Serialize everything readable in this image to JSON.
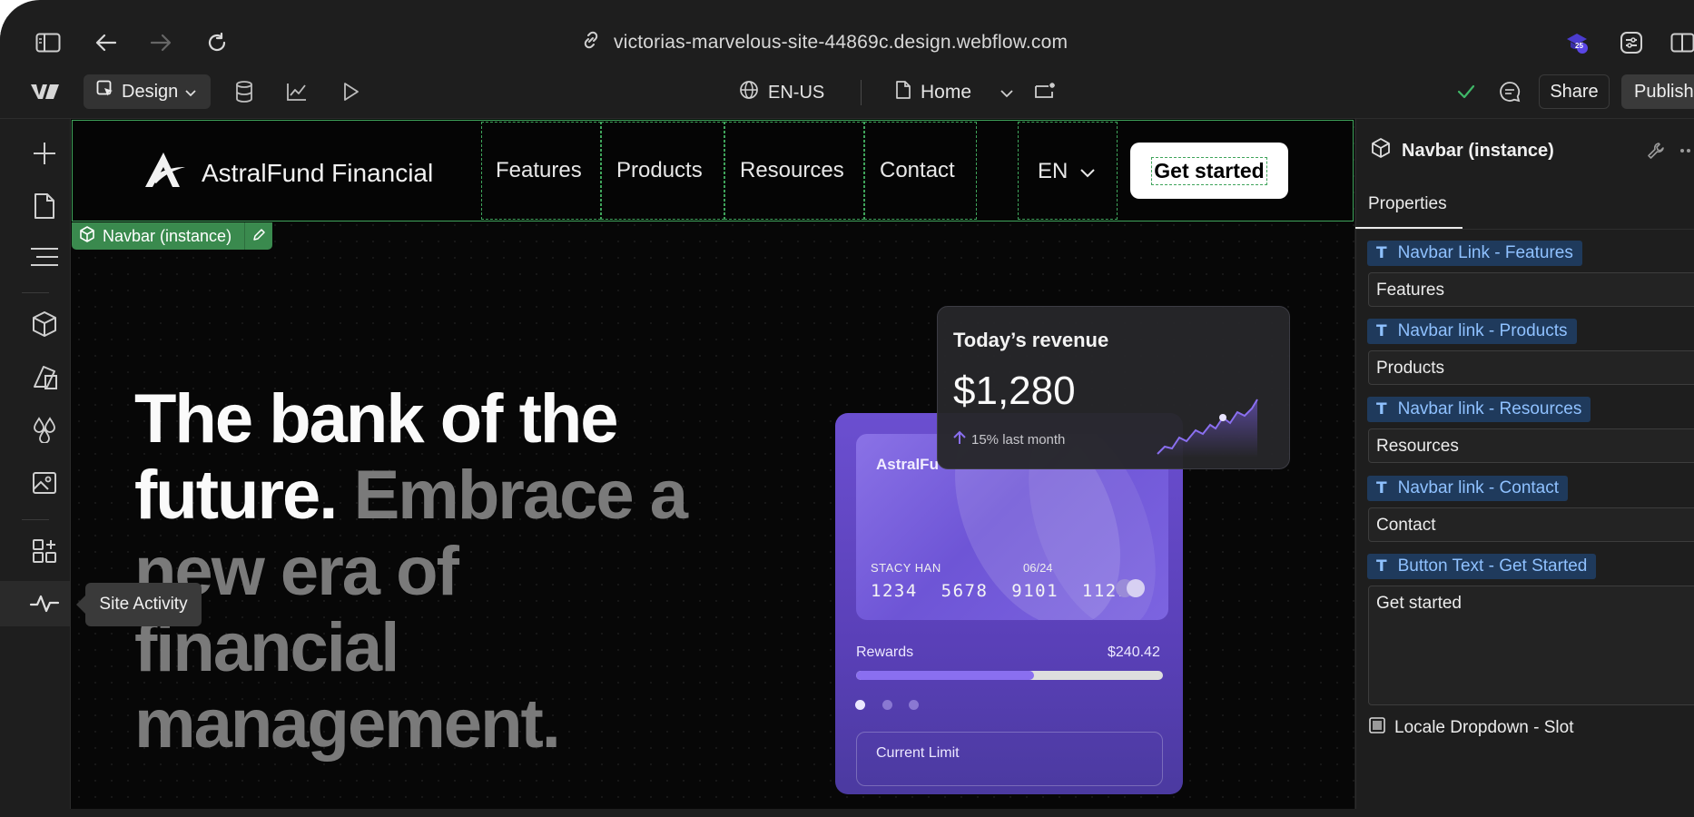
{
  "browser": {
    "url": "victorias-marvelous-site-44869c.design.webflow.com",
    "extension_badge": "25"
  },
  "toolbar": {
    "mode_label": "Design",
    "locale_label": "EN-US",
    "page_label": "Home",
    "share_label": "Share",
    "publish_label": "Publish"
  },
  "leftbar": {
    "tooltip": "Site Activity"
  },
  "site": {
    "brand": "AstralFund Financial",
    "nav_links": [
      "Features",
      "Products",
      "Resources",
      "Contact"
    ],
    "language": "EN",
    "cta": "Get started",
    "hero_bright": "The bank of the future.",
    "hero_dim": "Embrace a new era of financial management.",
    "revenue": {
      "title": "Today’s revenue",
      "amount": "$1,280",
      "change": "15% last month"
    },
    "card": {
      "brand": "AstralFu",
      "holder": "STACY HAN",
      "expiry": "06/24",
      "number": "1234  5678  9101  1121",
      "rewards_label": "Rewards",
      "rewards_value": "$240.42",
      "rewards_progress": 0.58,
      "limit_label": "Current Limit"
    }
  },
  "selection": {
    "tag": "Navbar (instance)"
  },
  "panel": {
    "title": "Navbar (instance)",
    "tab": "Properties",
    "props": [
      {
        "label": "Navbar Link - Features",
        "value": "Features"
      },
      {
        "label": "Navbar link - Products",
        "value": "Products"
      },
      {
        "label": "Navbar link - Resources",
        "value": "Resources"
      },
      {
        "label": "Navbar link - Contact",
        "value": "Contact"
      },
      {
        "label": "Button Text - Get Started",
        "value": "Get started"
      }
    ],
    "slot_label": "Locale Dropdown - Slot"
  },
  "colors": {
    "selection_green": "#3fa45b",
    "card_purple": "#6b4fd0",
    "prop_label_blue": "#8fc1ff"
  }
}
